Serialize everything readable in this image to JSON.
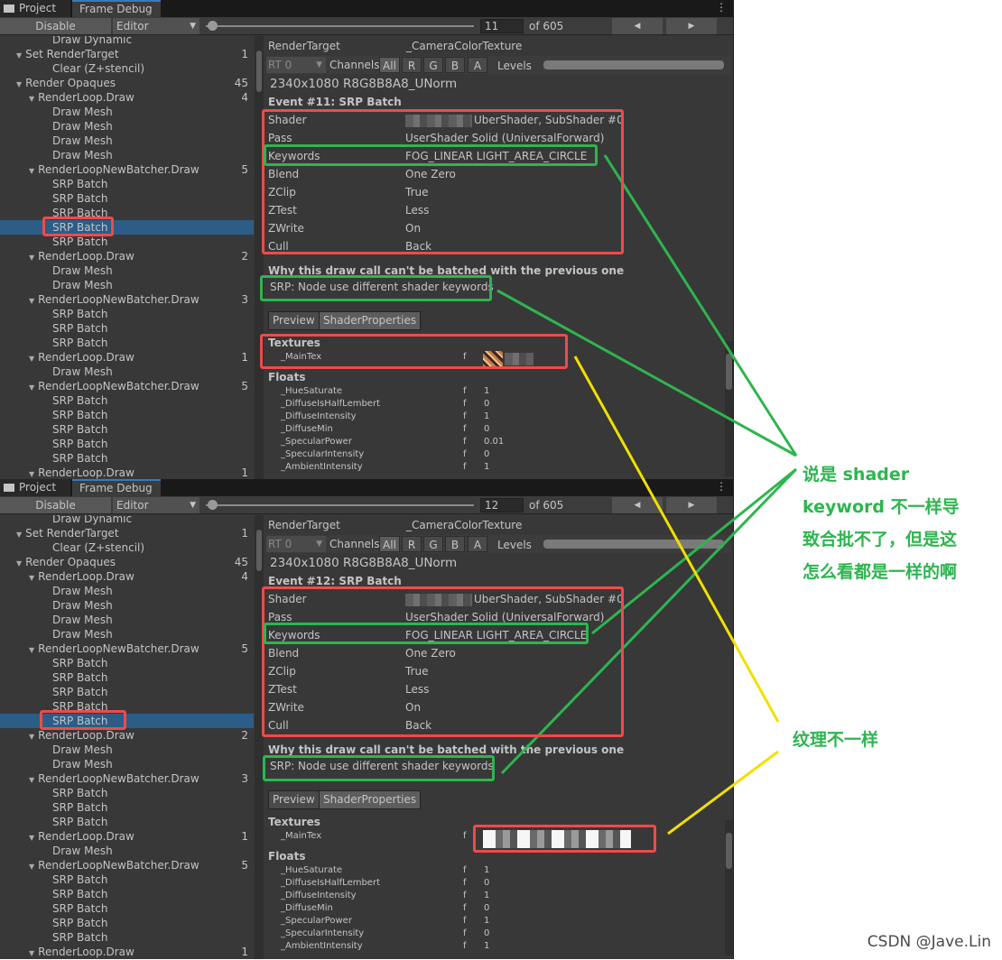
{
  "tabs": {
    "project": "Project",
    "frame_debug": "Frame Debug"
  },
  "toolbar": {
    "disable": "Disable",
    "editor": "Editor",
    "of_total": "of 605"
  },
  "tree_top": [
    {
      "label": "Draw Dynamic",
      "indent": 3,
      "count": ""
    },
    {
      "label": "Set RenderTarget",
      "indent": 1,
      "count": "1",
      "tri": "▼"
    },
    {
      "label": "Clear (Z+stencil)",
      "indent": 3,
      "count": ""
    },
    {
      "label": "Render Opaques",
      "indent": 1,
      "count": "45",
      "tri": "▼"
    },
    {
      "label": "RenderLoop.Draw",
      "indent": 2,
      "count": "4",
      "tri": "▼"
    },
    {
      "label": "Draw Mesh",
      "indent": 3,
      "count": ""
    },
    {
      "label": "Draw Mesh",
      "indent": 3,
      "count": ""
    },
    {
      "label": "Draw Mesh",
      "indent": 3,
      "count": ""
    },
    {
      "label": "Draw Mesh",
      "indent": 3,
      "count": ""
    },
    {
      "label": "RenderLoopNewBatcher.Draw",
      "indent": 2,
      "count": "5",
      "tri": "▼"
    },
    {
      "label": "SRP Batch",
      "indent": 3,
      "count": ""
    },
    {
      "label": "SRP Batch",
      "indent": 3,
      "count": ""
    },
    {
      "label": "SRP Batch",
      "indent": 3,
      "count": ""
    },
    {
      "label": "SRP Batch",
      "indent": 3,
      "count": ""
    },
    {
      "label": "SRP Batch",
      "indent": 3,
      "count": ""
    },
    {
      "label": "RenderLoop.Draw",
      "indent": 2,
      "count": "2",
      "tri": "▼"
    },
    {
      "label": "Draw Mesh",
      "indent": 3,
      "count": ""
    },
    {
      "label": "Draw Mesh",
      "indent": 3,
      "count": ""
    },
    {
      "label": "RenderLoopNewBatcher.Draw",
      "indent": 2,
      "count": "3",
      "tri": "▼"
    },
    {
      "label": "SRP Batch",
      "indent": 3,
      "count": ""
    },
    {
      "label": "SRP Batch",
      "indent": 3,
      "count": ""
    },
    {
      "label": "SRP Batch",
      "indent": 3,
      "count": ""
    },
    {
      "label": "RenderLoop.Draw",
      "indent": 2,
      "count": "1",
      "tri": "▼"
    },
    {
      "label": "Draw Mesh",
      "indent": 3,
      "count": ""
    },
    {
      "label": "RenderLoopNewBatcher.Draw",
      "indent": 2,
      "count": "5",
      "tri": "▼"
    },
    {
      "label": "SRP Batch",
      "indent": 3,
      "count": ""
    },
    {
      "label": "SRP Batch",
      "indent": 3,
      "count": ""
    },
    {
      "label": "SRP Batch",
      "indent": 3,
      "count": ""
    },
    {
      "label": "SRP Batch",
      "indent": 3,
      "count": ""
    },
    {
      "label": "SRP Batch",
      "indent": 3,
      "count": ""
    },
    {
      "label": "RenderLoop.Draw",
      "indent": 2,
      "count": "1",
      "tri": "▼"
    }
  ],
  "panels": [
    {
      "frame": "11",
      "selected_row": 13,
      "event": "Event #11: SRP Batch",
      "shader": "UberShader, SubShader #0",
      "texture_style": "thumb",
      "specular_power": "0.01"
    },
    {
      "frame": "12",
      "selected_row": 14,
      "event": "Event #12: SRP Batch",
      "shader": "UberShader, SubShader #0",
      "texture_style": "blur",
      "specular_power": "1"
    }
  ],
  "detail": {
    "render_target_label": "RenderTarget",
    "render_target_value": "_CameraColorTexture",
    "rt": "RT 0",
    "channels_label": "Channels",
    "channels": [
      "All",
      "R",
      "G",
      "B",
      "A"
    ],
    "levels": "Levels",
    "format": "2340x1080 R8G8B8A8_UNorm",
    "props": [
      {
        "k": "Shader",
        "v": ""
      },
      {
        "k": "Pass",
        "v": "UserShader Solid (UniversalForward)"
      },
      {
        "k": "Keywords",
        "v": "FOG_LINEAR LIGHT_AREA_CIRCLE"
      },
      {
        "k": "Blend",
        "v": "One Zero"
      },
      {
        "k": "ZClip",
        "v": "True"
      },
      {
        "k": "ZTest",
        "v": "Less"
      },
      {
        "k": "ZWrite",
        "v": "On"
      },
      {
        "k": "Cull",
        "v": "Back"
      }
    ],
    "why": "Why this draw call can't be batched with the previous one",
    "reason": "SRP: Node use different shader keywords",
    "preview_tab": "Preview",
    "shader_props_tab": "ShaderProperties",
    "textures_title": "Textures",
    "texture_name": "_MainTex",
    "floats_title": "Floats",
    "float_type": "f",
    "floats": [
      {
        "k": "_HueSaturate",
        "v": "1"
      },
      {
        "k": "_DiffuseIsHalfLembert",
        "v": "0"
      },
      {
        "k": "_DiffuseIntensity",
        "v": "1"
      },
      {
        "k": "_DiffuseMin",
        "v": "0"
      },
      {
        "k": "_SpecularPower",
        "v": ""
      },
      {
        "k": "_SpecularIntensity",
        "v": "0"
      },
      {
        "k": "_AmbientIntensity",
        "v": "1"
      }
    ]
  },
  "annotations": {
    "green_lines": [
      "说是 shader",
      "keyword 不一样导",
      "致合批不了，但是这",
      "怎么看都是一样的啊"
    ],
    "yellow": "纹理不一样",
    "green_color": "#2eb54f",
    "yellow_color": "#f0e000",
    "red_color": "#f04a4a"
  },
  "watermark": "CSDN @Jave.Lin"
}
